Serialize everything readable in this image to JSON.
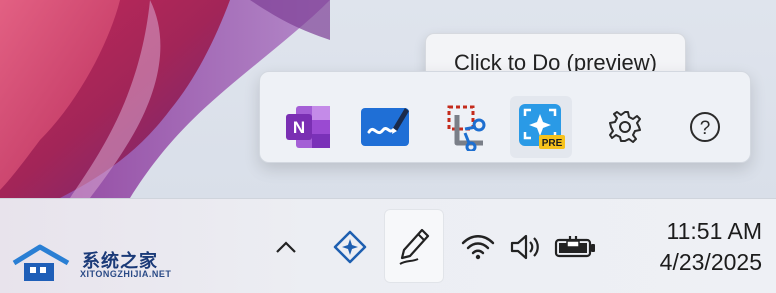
{
  "tooltip": {
    "text": "Click to Do (preview)"
  },
  "flyout": {
    "items": [
      {
        "icon": "onenote-icon",
        "letter": "N"
      },
      {
        "icon": "whiteboard-icon"
      },
      {
        "icon": "snipping-tool-icon"
      },
      {
        "icon": "click-to-do-icon",
        "badge": "PRE"
      },
      {
        "icon": "settings-gear-icon"
      },
      {
        "icon": "help-icon",
        "glyph": "?"
      }
    ]
  },
  "taskbar": {
    "icons": [
      "chevron-up-icon",
      "copilot-diamond-icon",
      "pen-icon",
      "wifi-icon",
      "volume-icon",
      "battery-charging-icon"
    ],
    "clock": {
      "time": "11:51 AM",
      "date": "4/23/2025"
    }
  },
  "watermark": {
    "cn": "系统之家",
    "en": "XITONGZHIJIA.NET"
  },
  "colors": {
    "accent": "#0f6cbd",
    "onenote": "#7a3bbd",
    "snip_red": "#c42b1c",
    "pre_badge": "#f6c21c"
  }
}
